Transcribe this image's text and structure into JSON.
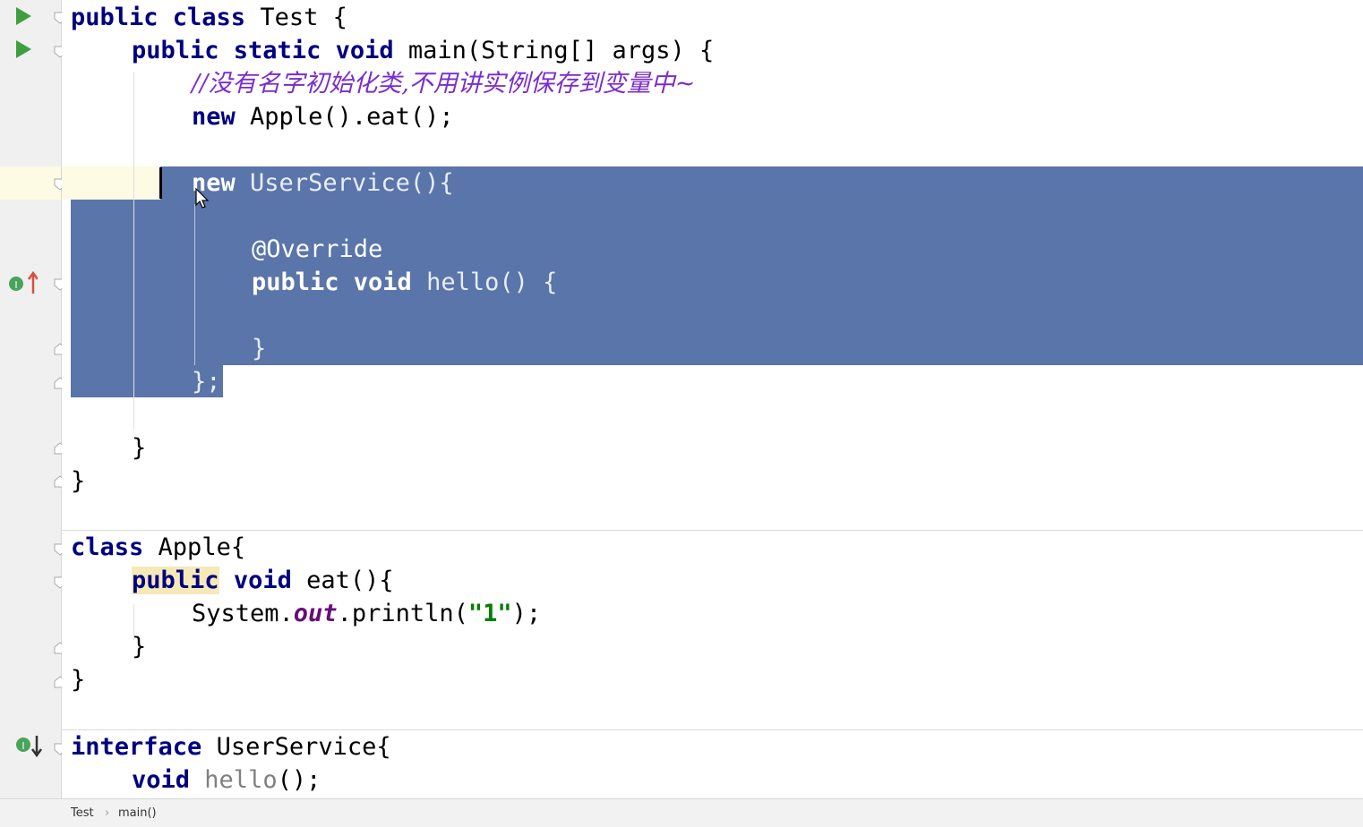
{
  "code": {
    "line1": {
      "kw": "public class",
      "name": "Test {"
    },
    "line2": {
      "kw": "public static void",
      "rest": "main(String[] args) {"
    },
    "line3": {
      "comment": "//没有名字初始化类,不用讲实例保存到变量中~"
    },
    "line4": {
      "kw": "new",
      "rest": "Apple().eat();"
    },
    "line6": {
      "kw": "new",
      "rest": "UserService(){"
    },
    "line8": {
      "annotation": "@Override"
    },
    "line9": {
      "kw": "public void",
      "rest": "hello() {"
    },
    "line11": {
      "text": "}"
    },
    "line12": {
      "text": "};"
    },
    "line14": {
      "text": "}"
    },
    "line15": {
      "text": "}"
    },
    "line17": {
      "kw": "class",
      "rest": "Apple{"
    },
    "line18": {
      "kw1": "public",
      "kw2": "void",
      "rest": "eat(){"
    },
    "line19": {
      "pre": "System.",
      "field": "out",
      "mid": ".println(",
      "str": "\"1\"",
      "post": ");"
    },
    "line20": {
      "text": "}"
    },
    "line21": {
      "text": "}"
    },
    "line23": {
      "kw": "interface",
      "rest": "UserService{"
    },
    "line24": {
      "kw": "void",
      "gray": "hello",
      "rest": "();"
    }
  },
  "breadcrumb": {
    "items": [
      "Test",
      "main()"
    ],
    "separator": "›"
  },
  "colors": {
    "keyword": "#000080",
    "selection": "#5a75a9",
    "comment": "#7a2ccf",
    "string": "#008000",
    "run": "#3f9f3f"
  }
}
